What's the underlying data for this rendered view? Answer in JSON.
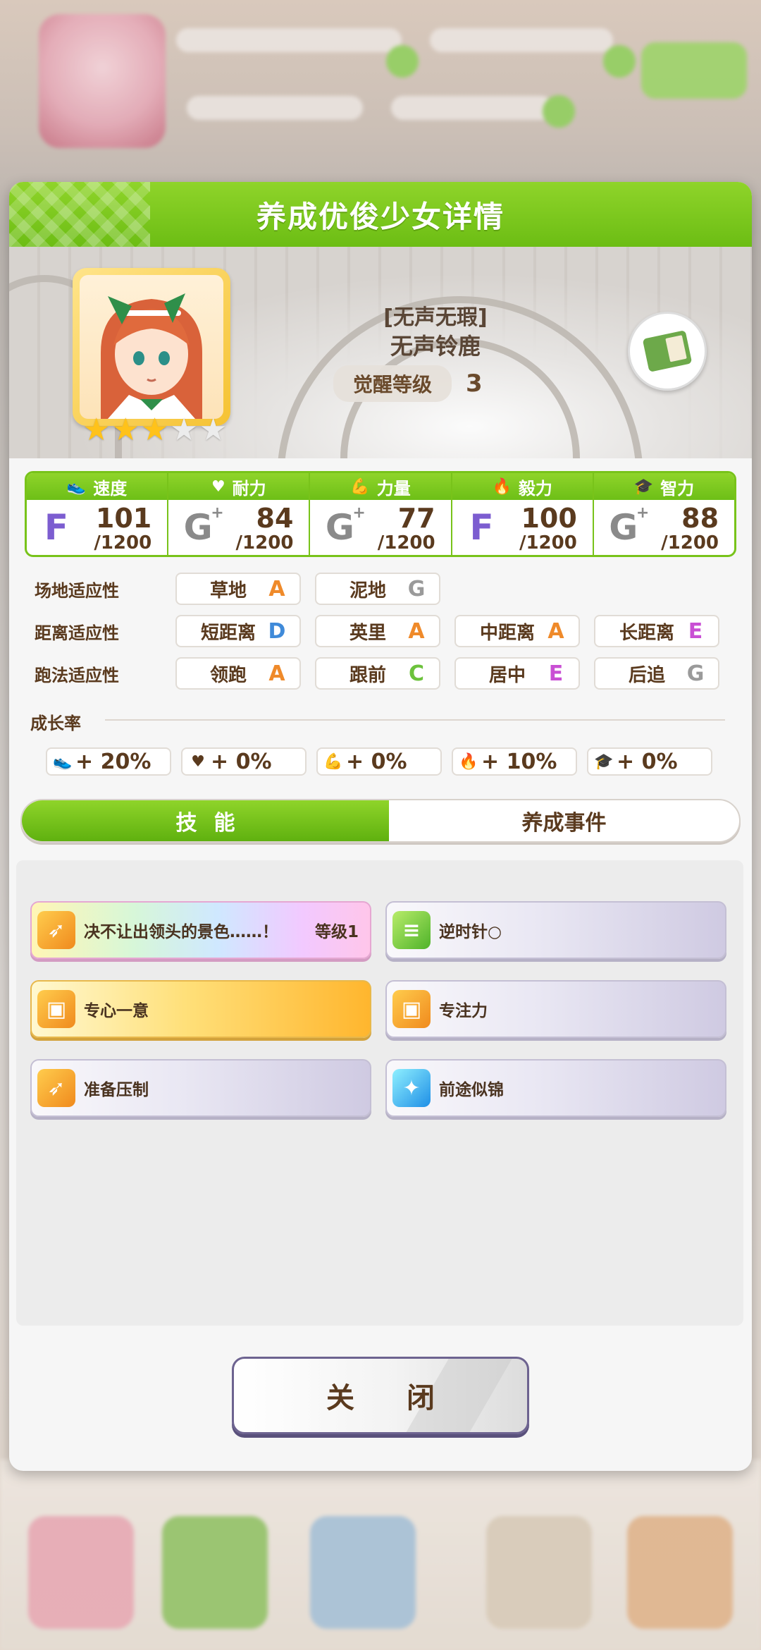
{
  "modal": {
    "title": "养成优俊少女详情",
    "close_label": "关 闭"
  },
  "character": {
    "epithet": "[无声无瑕]",
    "name": "无声铃鹿",
    "awakening_label": "觉醒等级",
    "awakening_level": "3",
    "stars_filled": 3,
    "stars_total": 5
  },
  "stats": [
    {
      "label": "速度",
      "icon": "shoe-icon",
      "grade": "F",
      "plus": false,
      "value": "101",
      "max": "/1200"
    },
    {
      "label": "耐力",
      "icon": "heart-icon",
      "grade": "G",
      "plus": true,
      "value": "84",
      "max": "/1200"
    },
    {
      "label": "力量",
      "icon": "muscle-icon",
      "grade": "G",
      "plus": true,
      "value": "77",
      "max": "/1200"
    },
    {
      "label": "毅力",
      "icon": "flame-icon",
      "grade": "F",
      "plus": false,
      "value": "100",
      "max": "/1200"
    },
    {
      "label": "智力",
      "icon": "graduation-cap-icon",
      "grade": "G",
      "plus": true,
      "value": "88",
      "max": "/1200"
    }
  ],
  "aptitudes": [
    {
      "label": "场地适应性",
      "items": [
        {
          "name": "草地",
          "grade": "A"
        },
        {
          "name": "泥地",
          "grade": "G"
        }
      ]
    },
    {
      "label": "距离适应性",
      "items": [
        {
          "name": "短距离",
          "grade": "D"
        },
        {
          "name": "英里",
          "grade": "A"
        },
        {
          "name": "中距离",
          "grade": "A"
        },
        {
          "name": "长距离",
          "grade": "E"
        }
      ]
    },
    {
      "label": "跑法适应性",
      "items": [
        {
          "name": "领跑",
          "grade": "A"
        },
        {
          "name": "跟前",
          "grade": "C"
        },
        {
          "name": "居中",
          "grade": "E"
        },
        {
          "name": "后追",
          "grade": "G"
        }
      ]
    }
  ],
  "growth": {
    "title": "成长率",
    "items": [
      {
        "icon": "shoe-icon",
        "value": "+ 20%"
      },
      {
        "icon": "heart-icon",
        "value": "+ 0%"
      },
      {
        "icon": "muscle-icon",
        "value": "+ 0%"
      },
      {
        "icon": "flame-icon",
        "value": "+ 10%"
      },
      {
        "icon": "graduation-cap-icon",
        "value": "+ 0%"
      }
    ]
  },
  "tabs": {
    "skills": "技能",
    "events": "养成事件"
  },
  "skills": [
    {
      "name": "决不让出领头的景色……！",
      "level": "等级1",
      "style": "rainbow",
      "icon": "speed-burst-icon"
    },
    {
      "name": "逆时针○",
      "level": "",
      "style": "normal",
      "icon": "track-icon"
    },
    {
      "name": "专心一意",
      "level": "",
      "style": "gold",
      "icon": "gate-icon"
    },
    {
      "name": "专注力",
      "level": "",
      "style": "normal",
      "icon": "gate-icon"
    },
    {
      "name": "准备压制",
      "level": "",
      "style": "normal",
      "icon": "speed-burst-icon"
    },
    {
      "name": "前途似锦",
      "level": "",
      "style": "normal",
      "icon": "sparkle-icon"
    }
  ]
}
